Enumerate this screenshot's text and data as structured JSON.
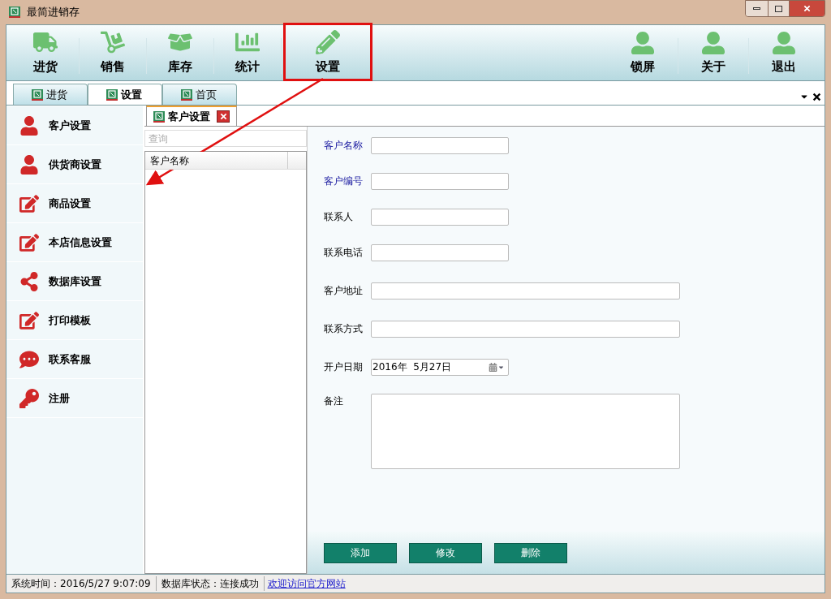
{
  "window": {
    "title": "最简进销存"
  },
  "toolbar": {
    "left": [
      {
        "label": "进货",
        "highlighted": false
      },
      {
        "label": "销售",
        "highlighted": false
      },
      {
        "label": "库存",
        "highlighted": false
      },
      {
        "label": "统计",
        "highlighted": false
      },
      {
        "label": "设置",
        "highlighted": true
      }
    ],
    "right": [
      {
        "label": "锁屏"
      },
      {
        "label": "关于"
      },
      {
        "label": "退出"
      }
    ]
  },
  "tabs": [
    {
      "label": "进货",
      "selected": false
    },
    {
      "label": "设置",
      "selected": true
    },
    {
      "label": "首页",
      "selected": false
    }
  ],
  "sidebar": {
    "items": [
      {
        "label": "客户设置"
      },
      {
        "label": "供货商设置"
      },
      {
        "label": "商品设置"
      },
      {
        "label": "本店信息设置"
      },
      {
        "label": "数据库设置"
      },
      {
        "label": "打印模板"
      },
      {
        "label": "联系客服"
      },
      {
        "label": "注册"
      }
    ]
  },
  "document_tab": {
    "label": "客户设置"
  },
  "list": {
    "search_placeholder": "查询",
    "columns": [
      "客户名称"
    ]
  },
  "form": {
    "fields": [
      {
        "label": "客户名称",
        "kind": "short",
        "required": true
      },
      {
        "label": "客户编号",
        "kind": "short",
        "required": true
      },
      {
        "label": "联系人",
        "kind": "short",
        "required": false
      },
      {
        "label": "联系电话",
        "kind": "short",
        "required": false
      },
      {
        "label": "客户地址",
        "kind": "wide",
        "required": false
      },
      {
        "label": "联系方式",
        "kind": "wide",
        "required": false
      },
      {
        "label": "开户日期",
        "kind": "date",
        "required": false,
        "value": "2016年  5月27日"
      },
      {
        "label": "备注",
        "kind": "memo",
        "required": false
      }
    ],
    "buttons": [
      "添加",
      "修改",
      "删除"
    ]
  },
  "status_bar": {
    "items": [
      "系统时间：2016/5/27 9:07:09",
      "数据库状态：连接成功"
    ],
    "link": "欢迎访问官方网站"
  }
}
